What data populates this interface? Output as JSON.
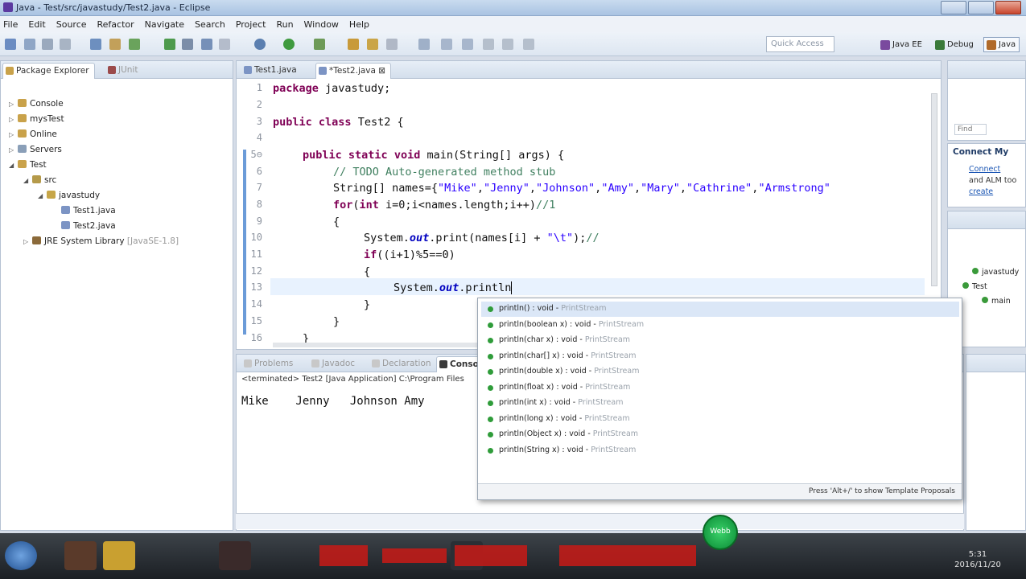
{
  "window": {
    "title": "Java - Test/src/javastudy/Test2.java - Eclipse"
  },
  "menu": [
    "File",
    "Edit",
    "Source",
    "Refactor",
    "Navigate",
    "Search",
    "Project",
    "Run",
    "Window",
    "Help"
  ],
  "toolbar": {
    "quick_access_placeholder": "Quick Access"
  },
  "perspectives": [
    {
      "label": "Java EE",
      "color": "#7a4a9e"
    },
    {
      "label": "Debug",
      "color": "#3a7a3a"
    },
    {
      "label": "Java",
      "color": "#b06a2a"
    }
  ],
  "package_explorer": {
    "tabs": [
      "Package Explorer",
      "JUnit"
    ],
    "items": [
      {
        "label": "Console",
        "twisty": "▷"
      },
      {
        "label": "mysTest",
        "twisty": "▷"
      },
      {
        "label": "Online",
        "twisty": "▷"
      },
      {
        "label": "Servers",
        "twisty": "▷"
      },
      {
        "label": "Test",
        "twisty": "◢"
      },
      {
        "label": "src",
        "twisty": "◢"
      },
      {
        "label": "javastudy",
        "twisty": "◢"
      },
      {
        "label": "Test1.java",
        "twisty": ""
      },
      {
        "label": "Test2.java",
        "twisty": ""
      },
      {
        "label": "JRE System Library",
        "suffix": "[JavaSE-1.8]",
        "twisty": "▷"
      }
    ]
  },
  "editor": {
    "tabs": [
      "Test1.java",
      "*Test2.java"
    ],
    "line_numbers": [
      "1",
      "2",
      "3",
      "4",
      "5⊖",
      "6",
      "7",
      "8",
      "9",
      "10",
      "11",
      "12",
      "13",
      "14",
      "15",
      "16"
    ],
    "lines": {
      "l1_kw": "package",
      "l1_rest": " javastudy;",
      "l3_kw1": "public",
      "l3_kw2": "class",
      "l3_rest": " Test2 {",
      "l5_kw1": "public",
      "l5_kw2": "static",
      "l5_kw3": "void",
      "l5_rest": " main(String[] args) {",
      "l6_cm": "// TODO Auto-generated method stub",
      "l7_pre": "String[] names={",
      "l7_s1": "\"Mike\"",
      "l7_s2": "\"Jenny\"",
      "l7_s3": "\"Johnson\"",
      "l7_s4": "\"Amy\"",
      "l7_s5": "\"Mary\"",
      "l7_s6": "\"Cathrine\"",
      "l7_s7": "\"Armstrong\"",
      "l8_kw": "for",
      "l8_kw2": "int",
      "l8_rest": " i=0;i<names.length;i++)",
      "l8_cm": "//1",
      "l9": "{",
      "l10_pre": "System.",
      "l10_fd": "out",
      "l10_mid": ".print(names[i] + ",
      "l10_st": "\"\\t\"",
      "l10_end": ");",
      "l10_cm": "//",
      "l11_kw": "if",
      "l11_rest": "((i+1)%5==0)",
      "l12": "{",
      "l13_pre": "System.",
      "l13_fd": "out",
      "l13_rest": ".println",
      "l14": "}",
      "l15": "}",
      "l16": "}"
    }
  },
  "console": {
    "tabs": [
      "Problems",
      "Javadoc",
      "Declaration",
      "Console"
    ],
    "header": "<terminated> Test2 [Java Application] C:\\Program Files",
    "output": "Mike    Jenny   Johnson Amy"
  },
  "content_assist": {
    "proposals": [
      {
        "sig": "println() : void",
        "type": "PrintStream"
      },
      {
        "sig": "println(boolean x) : void",
        "type": "PrintStream"
      },
      {
        "sig": "println(char x) : void",
        "type": "PrintStream"
      },
      {
        "sig": "println(char[] x) : void",
        "type": "PrintStream"
      },
      {
        "sig": "println(double x) : void",
        "type": "PrintStream"
      },
      {
        "sig": "println(float x) : void",
        "type": "PrintStream"
      },
      {
        "sig": "println(int x) : void",
        "type": "PrintStream"
      },
      {
        "sig": "println(long x) : void",
        "type": "PrintStream"
      },
      {
        "sig": "println(Object x) : void",
        "type": "PrintStream"
      },
      {
        "sig": "println(String x) : void",
        "type": "PrintStream"
      }
    ],
    "footer": "Press 'Alt+/' to show Template Proposals"
  },
  "right_panels": {
    "find_label": "Find",
    "mylyn_title": "Connect My",
    "mylyn_link1": "Connect",
    "mylyn_text": "and ALM too",
    "mylyn_link2": "create",
    "outline_items": [
      "javastudy",
      "Test",
      "main"
    ]
  },
  "taskbar": {
    "badge": "Webb",
    "clock_time": "5:31",
    "clock_date": "2016/11/20"
  }
}
